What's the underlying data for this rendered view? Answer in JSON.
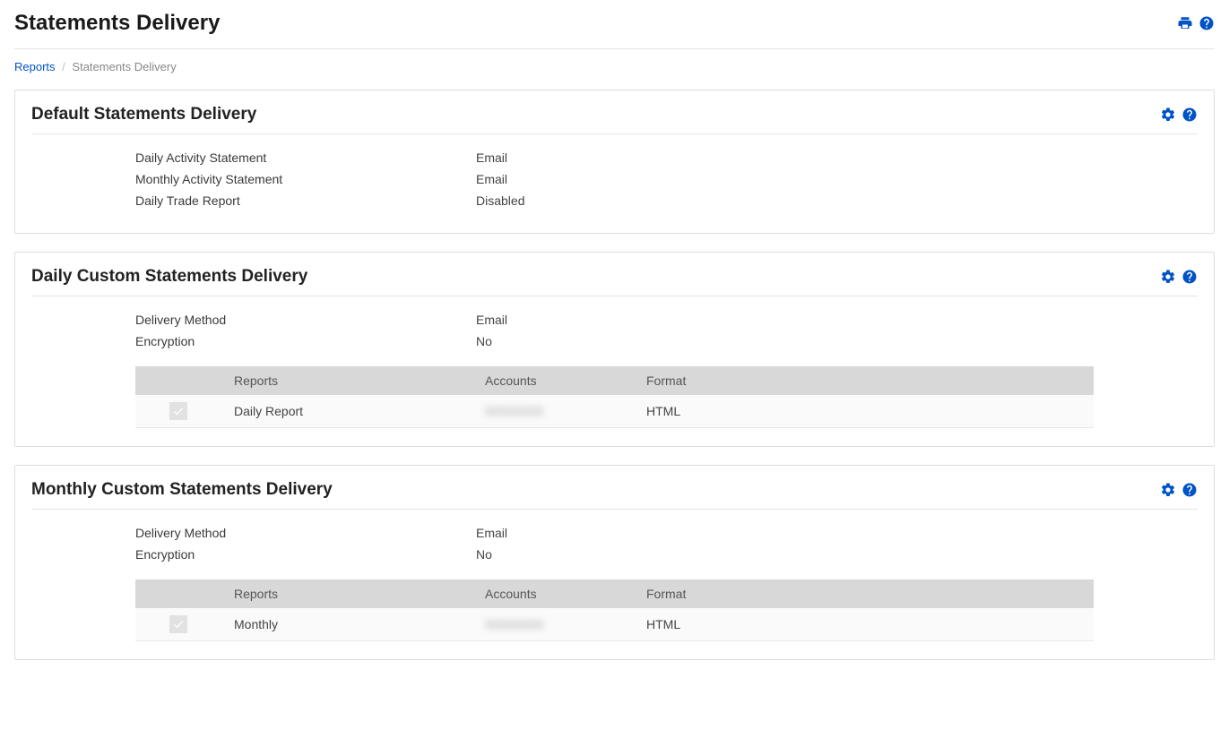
{
  "header": {
    "title": "Statements Delivery"
  },
  "breadcrumb": {
    "root": "Reports",
    "current": "Statements Delivery"
  },
  "panel_default": {
    "title": "Default Statements Delivery",
    "rows": [
      {
        "label": "Daily Activity Statement",
        "value": "Email"
      },
      {
        "label": "Monthly Activity Statement",
        "value": "Email"
      },
      {
        "label": "Daily Trade Report",
        "value": "Disabled"
      }
    ]
  },
  "panel_daily": {
    "title": "Daily Custom Statements Delivery",
    "rows": [
      {
        "label": "Delivery Method",
        "value": "Email"
      },
      {
        "label": "Encryption",
        "value": "No"
      }
    ],
    "table": {
      "headers": {
        "reports": "Reports",
        "accounts": "Accounts",
        "format": "Format"
      },
      "rows": [
        {
          "report": "Daily Report",
          "account": "",
          "format": "HTML"
        }
      ]
    }
  },
  "panel_monthly": {
    "title": "Monthly Custom Statements Delivery",
    "rows": [
      {
        "label": "Delivery Method",
        "value": "Email"
      },
      {
        "label": "Encryption",
        "value": "No"
      }
    ],
    "table": {
      "headers": {
        "reports": "Reports",
        "accounts": "Accounts",
        "format": "Format"
      },
      "rows": [
        {
          "report": "Monthly",
          "account": "",
          "format": "HTML"
        }
      ]
    }
  }
}
